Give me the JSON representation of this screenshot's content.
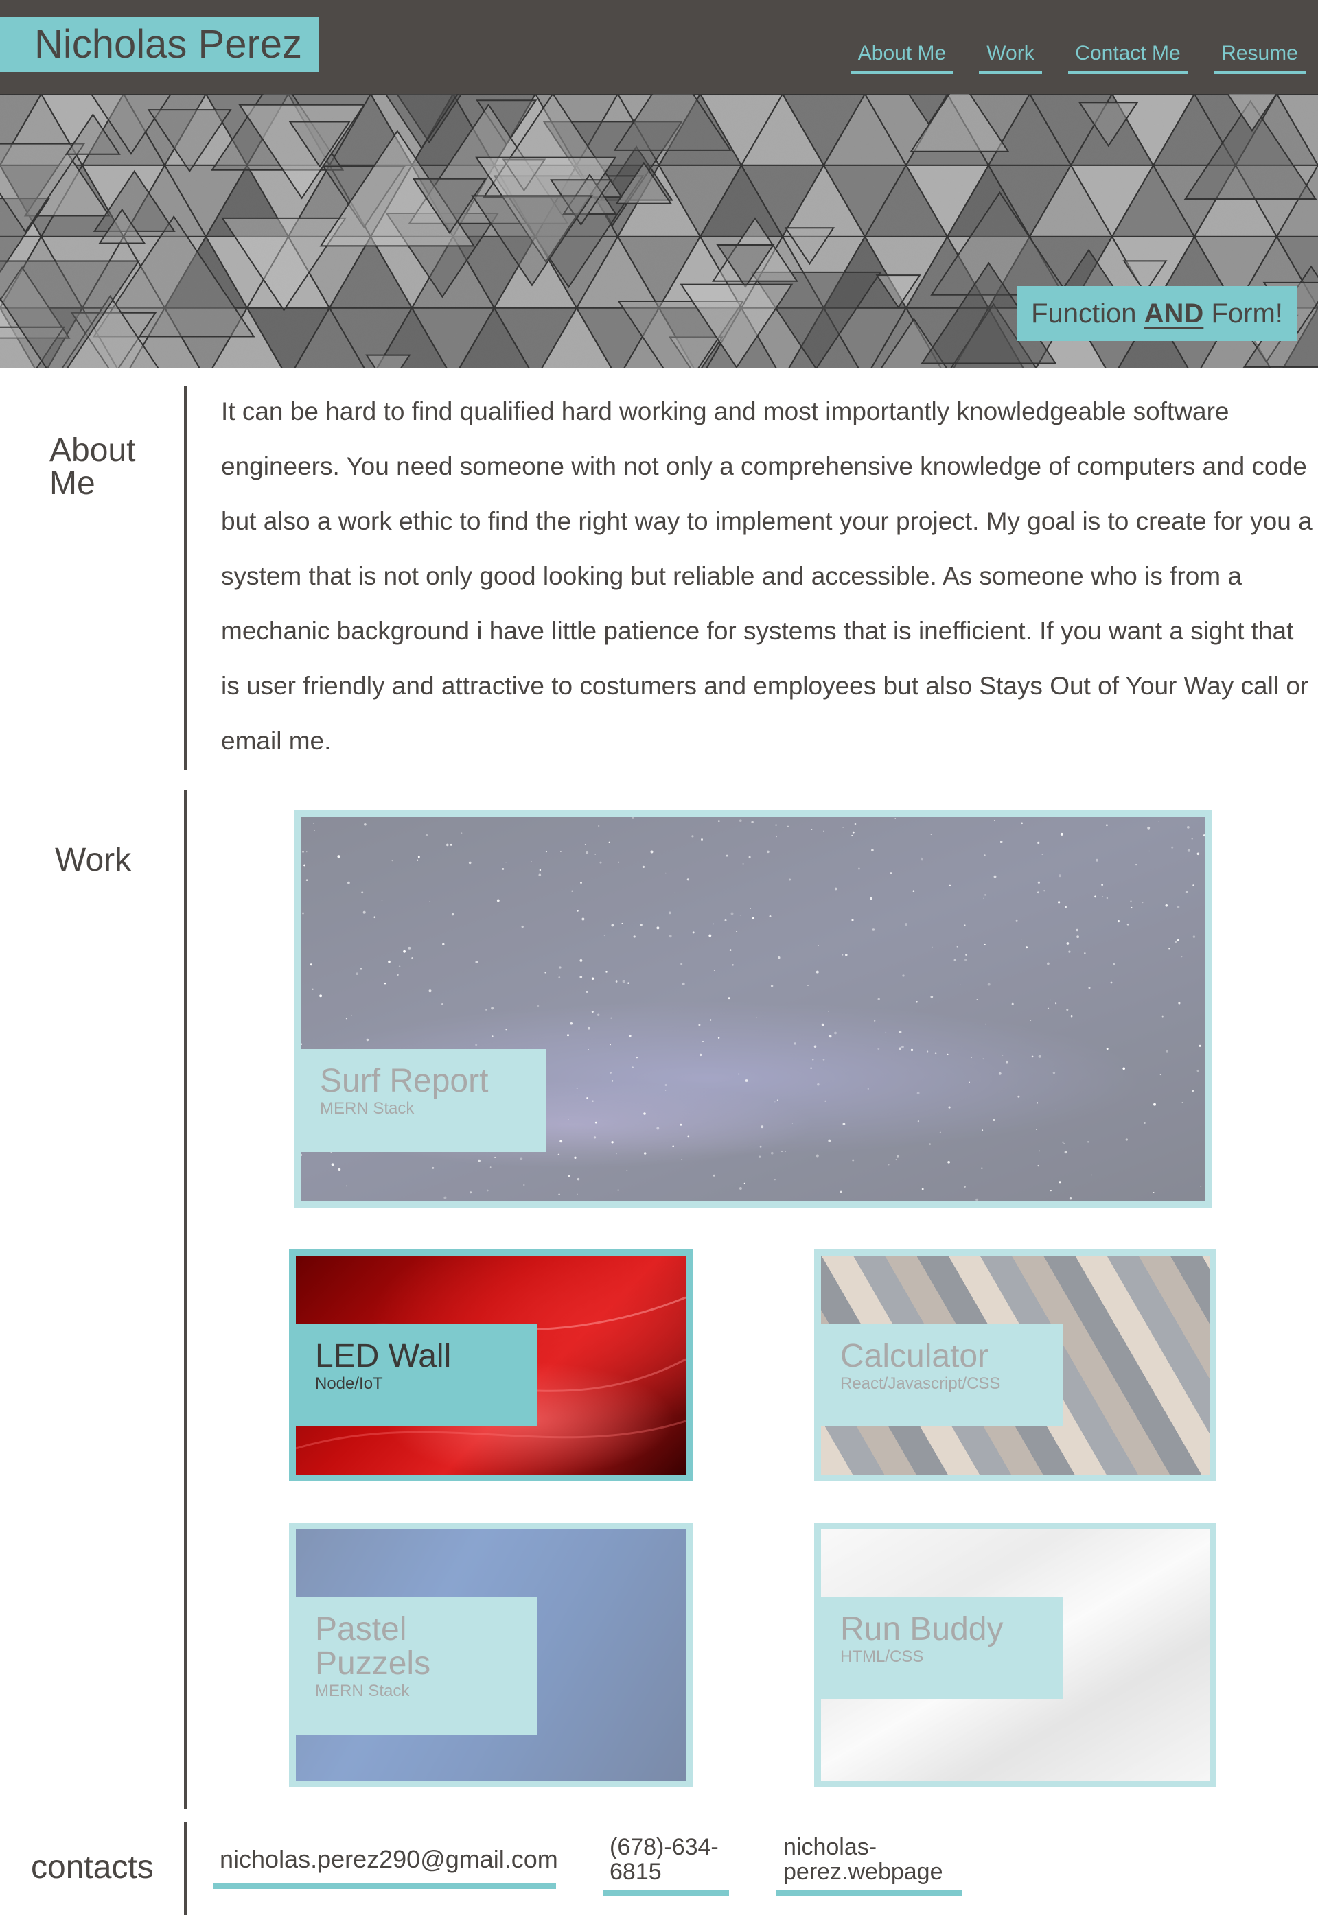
{
  "header": {
    "site_name": "Nicholas Perez",
    "nav": [
      {
        "label": "About Me"
      },
      {
        "label": "Work"
      },
      {
        "label": "Contact Me"
      },
      {
        "label": "Resume"
      }
    ]
  },
  "hero": {
    "tagline_pre": "Function ",
    "tagline_strong": "AND",
    "tagline_post": " Form!"
  },
  "about": {
    "label": "About Me",
    "text": "It can be hard to find qualified hard working and most importantly knowledgeable software engineers. You need someone with not only a comprehensive knowledge of computers and code but also a work ethic to find the right way to implement your project. My goal is to create for you a system that is not only good looking but reliable and accessible. As someone who is from a mechanic background i have little patience for systems that is inefficient. If you want a sight that is user friendly and attractive to costumers and employees but also Stays Out of Your Way call or email me."
  },
  "work": {
    "label": "Work",
    "projects": [
      {
        "title": "Surf Report",
        "stack": "MERN Stack"
      },
      {
        "title": "LED Wall",
        "stack": "Node/IoT"
      },
      {
        "title": "Calculator",
        "stack": "React/Javascript/CSS"
      },
      {
        "title": "Pastel Puzzels",
        "stack": "MERN Stack"
      },
      {
        "title": "Run Buddy",
        "stack": "HTML/CSS"
      }
    ]
  },
  "contacts": {
    "label": "contacts",
    "email": "nicholas.perez290@gmail.com",
    "phone": "(678)-634-6815",
    "website": "nicholas-perez.webpage"
  },
  "colors": {
    "accent": "#7ecacd",
    "accent_light": "#bde3e5",
    "header_bg": "#4e4a47",
    "text": "#4a4643"
  },
  "icons": []
}
